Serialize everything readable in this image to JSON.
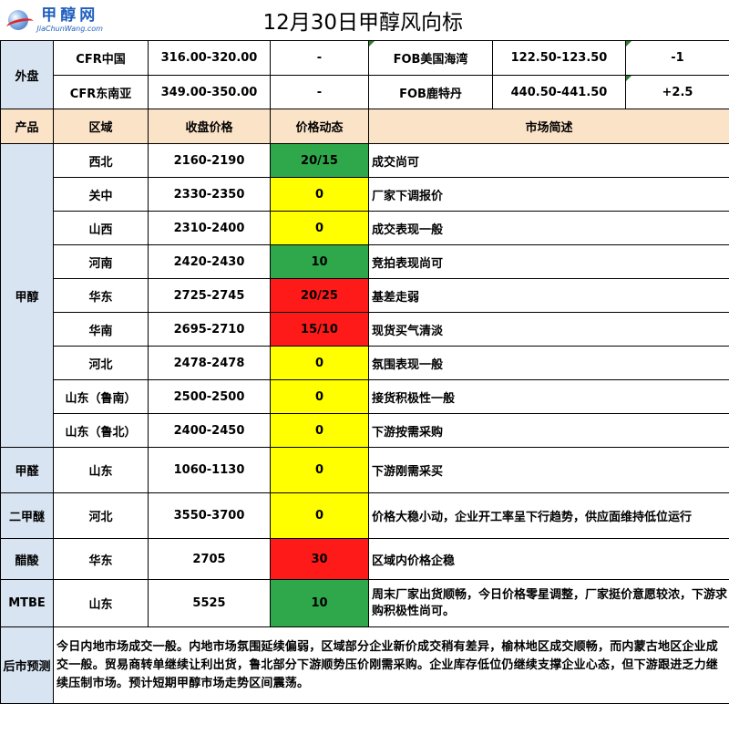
{
  "header": {
    "logo_cn": "甲醇网",
    "logo_en": "JiaChunWang.com",
    "title": "12月30日甲醇风向标"
  },
  "external": {
    "label": "外盘",
    "rows": [
      {
        "left_name": "CFR中国",
        "left_price": "316.00-320.00",
        "left_change": "-",
        "right_name": "FOB美国海湾",
        "right_price": "122.50-123.50",
        "right_change": "-1"
      },
      {
        "left_name": "CFR东南亚",
        "left_price": "349.00-350.00",
        "left_change": "-",
        "right_name": "FOB鹿特丹",
        "right_price": "440.50-441.50",
        "right_change": "+2.5"
      }
    ]
  },
  "columns": {
    "product": "产品",
    "region": "区域",
    "price": "收盘价格",
    "change": "价格动态",
    "summary": "市场简述"
  },
  "colors": {
    "up_green": "#2ea84a",
    "flat_yellow": "#ffff00",
    "down_red": "#ff1a1a",
    "side_blue": "#d8e4f2",
    "header_peach": "#fbe3c8"
  },
  "products": [
    {
      "name": "甲醇",
      "rows": [
        {
          "region": "西北",
          "price": "2160-2190",
          "change": "20/15",
          "trend": "green",
          "summary": "成交尚可"
        },
        {
          "region": "关中",
          "price": "2330-2350",
          "change": "0",
          "trend": "yellow",
          "summary": "厂家下调报价"
        },
        {
          "region": "山西",
          "price": "2310-2400",
          "change": "0",
          "trend": "yellow",
          "summary": "成交表现一般"
        },
        {
          "region": "河南",
          "price": "2420-2430",
          "change": "10",
          "trend": "green",
          "summary": "竞拍表现尚可"
        },
        {
          "region": "华东",
          "price": "2725-2745",
          "change": "20/25",
          "trend": "red",
          "summary": "基差走弱"
        },
        {
          "region": "华南",
          "price": "2695-2710",
          "change": "15/10",
          "trend": "red",
          "summary": "现货买气清淡"
        },
        {
          "region": "河北",
          "price": "2478-2478",
          "change": "0",
          "trend": "yellow",
          "summary": "氛围表现一般"
        },
        {
          "region": "山东（鲁南）",
          "price": "2500-2500",
          "change": "0",
          "trend": "yellow",
          "summary": "接货积极性一般"
        },
        {
          "region": "山东（鲁北）",
          "price": "2400-2450",
          "change": "0",
          "trend": "yellow",
          "summary": "下游按需采购"
        }
      ]
    },
    {
      "name": "甲醛",
      "rows": [
        {
          "region": "山东",
          "price": "1060-1130",
          "change": "0",
          "trend": "yellow",
          "summary": "下游刚需采买"
        }
      ]
    },
    {
      "name": "二甲醚",
      "rows": [
        {
          "region": "河北",
          "price": "3550-3700",
          "change": "0",
          "trend": "yellow",
          "summary": "价格大稳小动，企业开工率呈下行趋势，供应面维持低位运行"
        }
      ]
    },
    {
      "name": "醋酸",
      "rows": [
        {
          "region": "华东",
          "price": "2705",
          "change": "30",
          "trend": "red",
          "summary": "区域内价格企稳"
        }
      ]
    },
    {
      "name": "MTBE",
      "rows": [
        {
          "region": "山东",
          "price": "5525",
          "change": "10",
          "trend": "green",
          "summary": "周末厂家出货顺畅，今日价格零星调整，厂家挺价意愿较浓，下游求购积极性尚可。"
        }
      ]
    }
  ],
  "forecast": {
    "label": "后市预测",
    "text": "今日内地市场成交一般。内地市场氛围延续偏弱，区域部分企业新价成交稍有差异，榆林地区成交顺畅，而内蒙古地区企业成交一般。贸易商转单继续让利出货，鲁北部分下游顺势压价刚需采购。企业库存低位仍继续支撑企业心态，但下游跟进乏力继续压制市场。预计短期甲醇市场走势区间震荡。"
  }
}
